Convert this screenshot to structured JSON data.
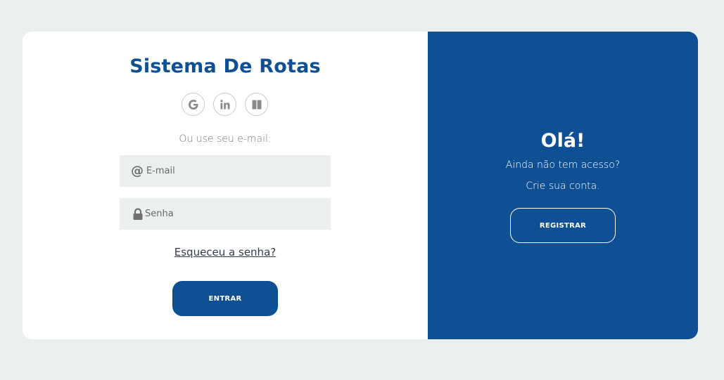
{
  "login": {
    "title": "Sistema De Rotas",
    "social": [
      "google-icon",
      "linkedin-icon",
      "window-icon"
    ],
    "email_hint": "Ou use seu e-mail:",
    "email_placeholder": "E-mail",
    "password_placeholder": "Senha",
    "forgot_label": "Esqueceu a senha?",
    "submit_label": "ENTRAR",
    "colors": {
      "brand": "#0e5093",
      "field_bg": "#ecefef",
      "page_bg": "#ecefef"
    }
  },
  "register_panel": {
    "heading": "Olá!",
    "line1": "Ainda não tem acesso?",
    "line2": "Crie sua conta.",
    "button_label": "REGISTRAR"
  }
}
